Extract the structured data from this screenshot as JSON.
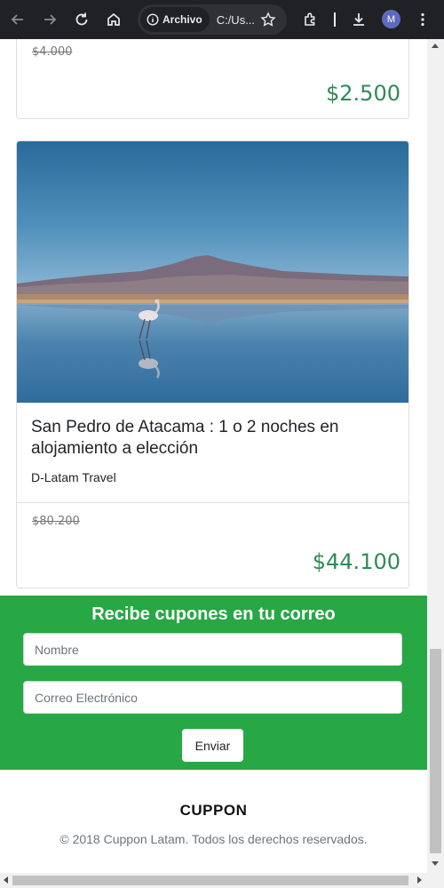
{
  "browser": {
    "security_chip": "Archivo",
    "url": "C:/Us...",
    "avatar_initial": "M"
  },
  "cards": [
    {
      "old_price": "$4.000",
      "new_price": "$2.500"
    },
    {
      "title": "San Pedro de Atacama : 1 o 2 noches en alojamiento a elección",
      "vendor": "D-Latam Travel",
      "old_price": "$80.200",
      "new_price": "$44.100"
    }
  ],
  "newsletter": {
    "title": "Recibe cupones en tu correo",
    "name_placeholder": "Nombre",
    "email_placeholder": "Correo Electrónico",
    "submit_label": "Enviar"
  },
  "footer": {
    "brand": "CUPPON",
    "copyright": "© 2018 Cuppon Latam. Todos los derechos reservados."
  },
  "colors": {
    "toolbar": "#202124",
    "accent_green": "#28a745",
    "price_green": "#2e8b57"
  }
}
